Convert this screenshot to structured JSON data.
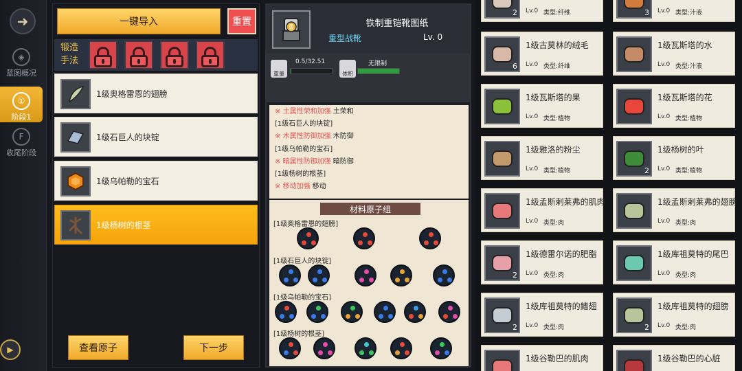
{
  "nav": {
    "items": [
      {
        "label": "蓝图概况",
        "active": false
      },
      {
        "label": "阶段1",
        "active": true
      },
      {
        "label": "收尾阶段",
        "active": false
      }
    ]
  },
  "left": {
    "import_button": "一键导入",
    "reset_button": "重置",
    "forge_label": "锻造手法",
    "forge_slots": [
      "locked",
      "locked",
      "locked",
      "locked"
    ],
    "materials": [
      {
        "name": "1级奥格雷恩的翅膀",
        "selected": false
      },
      {
        "name": "1级石巨人的块锭",
        "selected": false
      },
      {
        "name": "1级乌帕勒的宝石",
        "selected": false
      },
      {
        "name": "1级杨树的根茎",
        "selected": true
      }
    ],
    "view_atoms_button": "查看原子",
    "next_button": "下一步"
  },
  "middle": {
    "title": "铁制重铠靴图纸",
    "subtitle": "重型战靴",
    "level": "Lv. 0",
    "hero_badge": "重",
    "stats": [
      {
        "icon_label": "重量",
        "value": "0.5/32.51",
        "progress": 0.02
      },
      {
        "icon_label": "体积",
        "value": "无限制",
        "progress": 1.0
      }
    ],
    "effects": [
      {
        "mark": "※",
        "tag": "土属性荣和加强",
        "suffix": "土荣和"
      },
      {
        "title": "[1级石巨人的块锭]"
      },
      {
        "mark": "※",
        "tag": "木属性防御加强",
        "suffix": "木防御"
      },
      {
        "title": "[1级乌帕勒的宝石]"
      },
      {
        "mark": "※",
        "tag": "暗属性防御加强",
        "suffix": "暗防御"
      },
      {
        "title": "[1级杨树的根茎]"
      },
      {
        "mark": "※",
        "tag": "移动加强",
        "suffix": "移动"
      }
    ],
    "atom_banner": "材料原子组",
    "atom_groups": [
      {
        "title": "[1级奥格雷恩的翅膀]",
        "atoms": [
          [
            "#e84a3a",
            "#e84a3a",
            "#e84a3a"
          ],
          [
            "#e84a3a",
            "#e84a3a",
            "#e84a3a"
          ],
          [
            "#e84a3a",
            "#e84a3a",
            "#e84a3a"
          ]
        ]
      },
      {
        "title": "[1级石巨人的块锭]",
        "atoms": [
          [
            "#3a7be8",
            "#3a7be8",
            "#3a7be8"
          ],
          [
            "#3a7be8",
            "#3a7be8",
            "#3a7be8"
          ],
          [
            "#e84aa8",
            "#e84aa8",
            "#e84aa8"
          ],
          [
            "#e8a23a",
            "#e8a23a",
            "#e8a23a"
          ],
          [
            "#3a7be8",
            "#3a7be8",
            "#3a7be8"
          ],
          [
            "#3ac85a",
            "#3a7be8",
            "#3a7be8"
          ]
        ]
      },
      {
        "title": "[1级乌帕勒的宝石]",
        "atoms": [
          [
            "#e84a3a",
            "#3a7be8",
            "#3a7be8"
          ],
          [
            "#3ac85a",
            "#3a7be8",
            "#3a7be8"
          ],
          [
            "#3ac85a",
            "#e8a23a",
            "#e8a23a"
          ],
          [
            "#3a7be8",
            "#3a7be8",
            "#3a7be8"
          ],
          [
            "#3a9be8",
            "#e84a3a",
            "#e8a23a"
          ],
          [
            "#e84aa8",
            "#e84a3a",
            "#e84aa8"
          ]
        ]
      },
      {
        "title": "[1级杨树的根茎]",
        "atoms": [
          [
            "#e84a3a",
            "#3a7be8",
            "#e84a3a"
          ],
          [
            "#e84aa8",
            "#e84aa8",
            "#e84aa8"
          ],
          [
            "#3ac8c8",
            "#3ac85a",
            "#3ac85a"
          ],
          [
            "#e84a3a",
            "#e8a23a",
            "#e84a3a"
          ],
          [
            "#3ac85a",
            "#e84aa8",
            "#3a7be8"
          ]
        ]
      }
    ]
  },
  "right": {
    "cards": [
      {
        "name": "",
        "count": "2",
        "level": "Lv.0",
        "type": "类型:纤维",
        "icon": "fiber-icon",
        "color": "#d9c9bd"
      },
      {
        "name": "",
        "count": "3",
        "level": "Lv.0",
        "type": "类型:汁液",
        "icon": "jar-icon",
        "color": "#d17c3c"
      },
      {
        "name": "1级古莫林的绒毛",
        "count": "6",
        "level": "Lv.0",
        "type": "类型:纤维",
        "icon": "fluff-icon",
        "color": "#d8b9a8"
      },
      {
        "name": "1级瓦斯塔的水",
        "count": "",
        "level": "Lv.0",
        "type": "类型:汁液",
        "icon": "water-icon",
        "color": "#c48b66"
      },
      {
        "name": "1级瓦斯塔的果",
        "count": "",
        "level": "Lv.0",
        "type": "类型:植物",
        "icon": "fruit-icon",
        "color": "#8bc03b"
      },
      {
        "name": "1级瓦斯塔的花",
        "count": "",
        "level": "Lv.0",
        "type": "类型:植物",
        "icon": "flower-icon",
        "color": "#e8453b"
      },
      {
        "name": "1级雅洛的粉尘",
        "count": "",
        "level": "Lv.0",
        "type": "类型:植物",
        "icon": "dust-icon",
        "color": "#c49a6c"
      },
      {
        "name": "1级杨树的叶",
        "count": "2",
        "level": "Lv.0",
        "type": "类型:植物",
        "icon": "leaf-icon",
        "color": "#3e8c3a"
      },
      {
        "name": "1级孟斯剌莱弗的肌肉",
        "count": "",
        "level": "Lv.0",
        "type": "类型:肉",
        "icon": "meat-icon",
        "color": "#e8787a"
      },
      {
        "name": "1级孟斯剌莱弗的翅膀",
        "count": "",
        "level": "Lv.0",
        "type": "类型:肉",
        "icon": "wing-icon",
        "color": "#b8c49a"
      },
      {
        "name": "1级德雷尔诺的肥脂",
        "count": "2",
        "level": "Lv.0",
        "type": "类型:肉",
        "icon": "fat-icon",
        "color": "#e8a0a8"
      },
      {
        "name": "1级库祖莫特的尾巴",
        "count": "",
        "level": "Lv.0",
        "type": "类型:肉",
        "icon": "tail-icon",
        "color": "#6cc8b0"
      },
      {
        "name": "1级库祖莫特的鳍翅",
        "count": "2",
        "level": "Lv.0",
        "type": "类型:肉",
        "icon": "fin-icon",
        "color": "#c4ccd4"
      },
      {
        "name": "1级库祖莫特的翅膀",
        "count": "2",
        "level": "Lv.0",
        "type": "类型:肉",
        "icon": "wing-icon",
        "color": "#b8c49a"
      },
      {
        "name": "1级谷勒巴的肌肉",
        "count": "",
        "level": "",
        "type": "",
        "icon": "meat-icon",
        "color": "#e8787a"
      },
      {
        "name": "1级谷勒巴的心脏",
        "count": "",
        "level": "",
        "type": "",
        "icon": "heart-icon",
        "color": "#b8383c"
      }
    ]
  }
}
